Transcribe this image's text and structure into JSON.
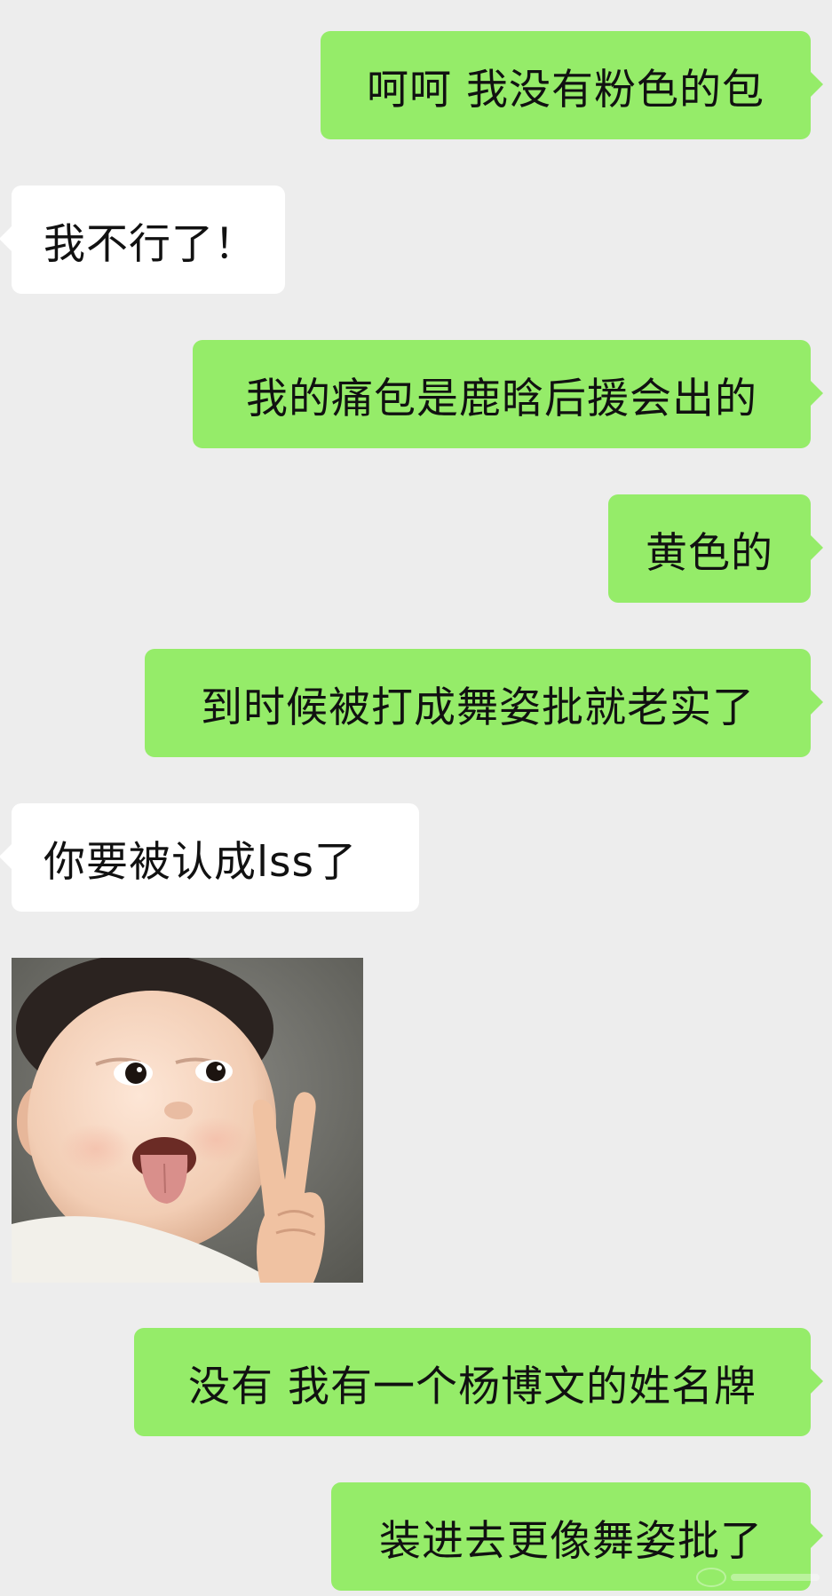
{
  "messages": [
    {
      "side": "sent",
      "text": "呵呵 我没有粉色的包"
    },
    {
      "side": "received",
      "text": "我不行了！"
    },
    {
      "side": "sent",
      "text": "我的痛包是鹿晗后援会出的"
    },
    {
      "side": "sent",
      "text": "黄色的"
    },
    {
      "side": "sent",
      "text": "到时候被打成舞姿批就老实了"
    },
    {
      "side": "received",
      "text": "你要被认成lss了"
    },
    {
      "side": "received",
      "type": "image",
      "image": "toddler-sticking-tongue-out-peace-sign"
    },
    {
      "side": "sent",
      "text": "没有 我有一个杨博文的姓名牌"
    },
    {
      "side": "sent",
      "text": "装进去更像舞姿批了"
    }
  ],
  "colors": {
    "background": "#ededed",
    "sent_bubble": "#95ec69",
    "received_bubble": "#ffffff",
    "text": "#111111"
  }
}
